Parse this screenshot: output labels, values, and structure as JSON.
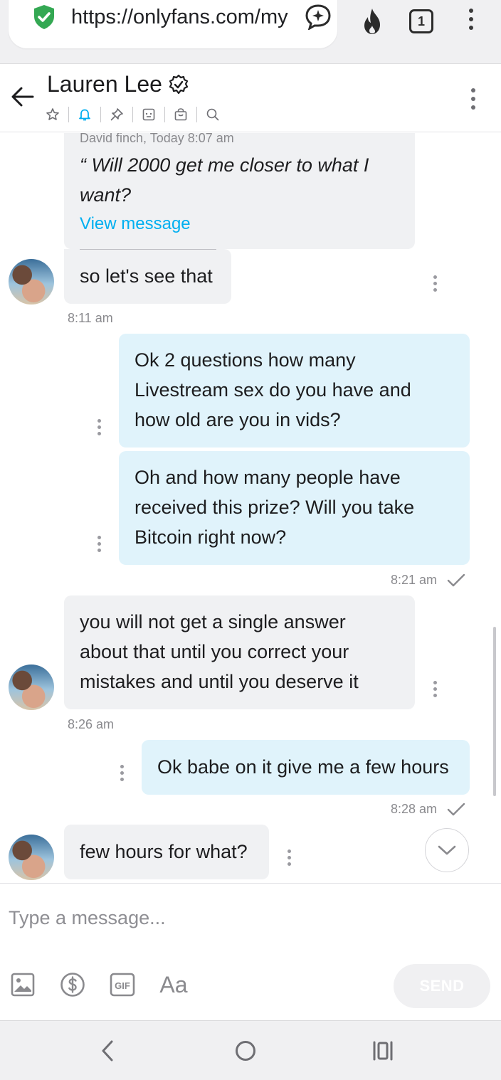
{
  "browser": {
    "url": "https://onlyfans.com/my",
    "tab_count": "1",
    "icons": [
      "shield-check-icon",
      "assistant-icon",
      "fire-icon",
      "tabs-icon",
      "menu-icon"
    ]
  },
  "chat_header": {
    "contact_name": "Lauren Lee",
    "icons": [
      "star-icon",
      "bell-icon",
      "pin-icon",
      "media-icon",
      "bag-icon",
      "search-icon"
    ]
  },
  "messages": {
    "quote": {
      "meta": "David finch, Today 8:07 am",
      "text_line1": "“ Will 2000 get me closer to what I",
      "text_line2": "want?",
      "link": "View message"
    },
    "m1": {
      "line1": "so let's see that",
      "time": "8:11 am"
    },
    "m2": {
      "line1": "Ok 2 questions how many",
      "line2": "Livestream sex do you have and",
      "line3": "how old are you in vids?"
    },
    "m3": {
      "line1": "Oh and how many people have",
      "line2": "received this prize? Will you take",
      "line3": "Bitcoin right now?",
      "time": "8:21 am"
    },
    "m4": {
      "line1": "you will not get a single answer",
      "line2": "about that until you correct your",
      "line3": "mistakes and until you deserve it",
      "time": "8:26 am"
    },
    "m5": {
      "line1": "Ok babe on it give me a few hours",
      "time": "8:28 am"
    },
    "m6": {
      "line1": "few hours for what?"
    }
  },
  "composer": {
    "placeholder": "Type a message...",
    "aa_label": "Aa",
    "gif_label": "GIF",
    "send_label": "SEND"
  },
  "colors": {
    "incoming_bubble": "#f0f1f3",
    "outgoing_bubble": "#e0f3fb",
    "link": "#00aff0",
    "shield": "#34a853"
  }
}
